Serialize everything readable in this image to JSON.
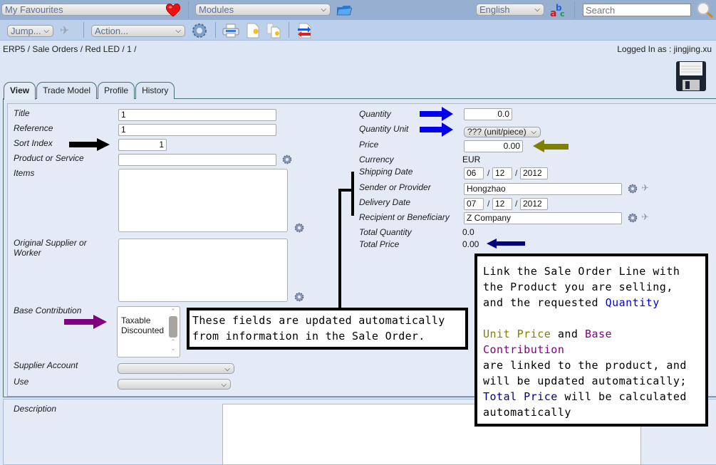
{
  "topbar": {
    "favourites_select": "My Favourites",
    "modules_select": "Modules",
    "language_select": "English",
    "search_placeholder": "Search"
  },
  "toolbar": {
    "jump_select": "Jump...",
    "action_select": "Action..."
  },
  "breadcrumb": "ERP5 / Sale Orders / Red LED / 1 /",
  "logged_in": "Logged In as : jingjing.xu",
  "tabs": [
    {
      "label": "View",
      "active": true
    },
    {
      "label": "Trade Model"
    },
    {
      "label": "Profile"
    },
    {
      "label": "History"
    }
  ],
  "left_form": {
    "title": {
      "label": "Title",
      "value": "1"
    },
    "reference": {
      "label": "Reference",
      "value": "1"
    },
    "sort_index": {
      "label": "Sort Index",
      "value": "1"
    },
    "product": {
      "label": "Product or Service",
      "value": ""
    },
    "items": {
      "label": "Items"
    },
    "original_supplier": {
      "label": "Original Supplier or Worker"
    },
    "base_contribution": {
      "label": "Base Contribution",
      "options": [
        "Taxable",
        "Discounted"
      ]
    },
    "supplier_account": {
      "label": "Supplier Account",
      "value": ""
    },
    "use": {
      "label": "Use",
      "value": ""
    }
  },
  "right_form": {
    "quantity": {
      "label": "Quantity",
      "value": "0.0"
    },
    "quantity_unit": {
      "label": "Quantity Unit",
      "value": "??? (unit/piece)"
    },
    "price": {
      "label": "Price",
      "value": "0.00"
    },
    "currency": {
      "label": "Currency",
      "value": "EUR"
    },
    "shipping_date": {
      "label": "Shipping Date",
      "day": "06",
      "month": "12",
      "year": "2012"
    },
    "sender": {
      "label": "Sender or Provider",
      "value": "Hongzhao"
    },
    "delivery_date": {
      "label": "Delivery Date",
      "day": "07",
      "month": "12",
      "year": "2012"
    },
    "recipient": {
      "label": "Recipient or Beneficiary",
      "value": "Z Company"
    },
    "total_quantity": {
      "label": "Total Quantity",
      "value": "0.0"
    },
    "total_price": {
      "label": "Total Price",
      "value": "0.00"
    }
  },
  "description": {
    "label": "Description",
    "value": ""
  },
  "callouts": {
    "auto_fields": {
      "line1": "These fields are updated automatically",
      "line2": "from information in the Sale Order."
    },
    "help": {
      "l1": "Link the Sale Order Line with",
      "l2": "the Product you are selling,",
      "l3a": "and the requested ",
      "l3b": "Quantity",
      "l4a": "Unit Price",
      "l4b": " and ",
      "l4c": "Base Contribution",
      "l5": "are linked to the product, and",
      "l6": "will be updated automatically;",
      "l7a": "Total Price",
      "l7b": " will be calculated",
      "l8": "automatically"
    }
  },
  "colors": {
    "quantity_arrow": "#0000ee",
    "price_arrow": "#808000",
    "base_contribution_arrow": "#800080",
    "total_price_arrow": "#000080",
    "sort_index_arrow": "#000000"
  }
}
